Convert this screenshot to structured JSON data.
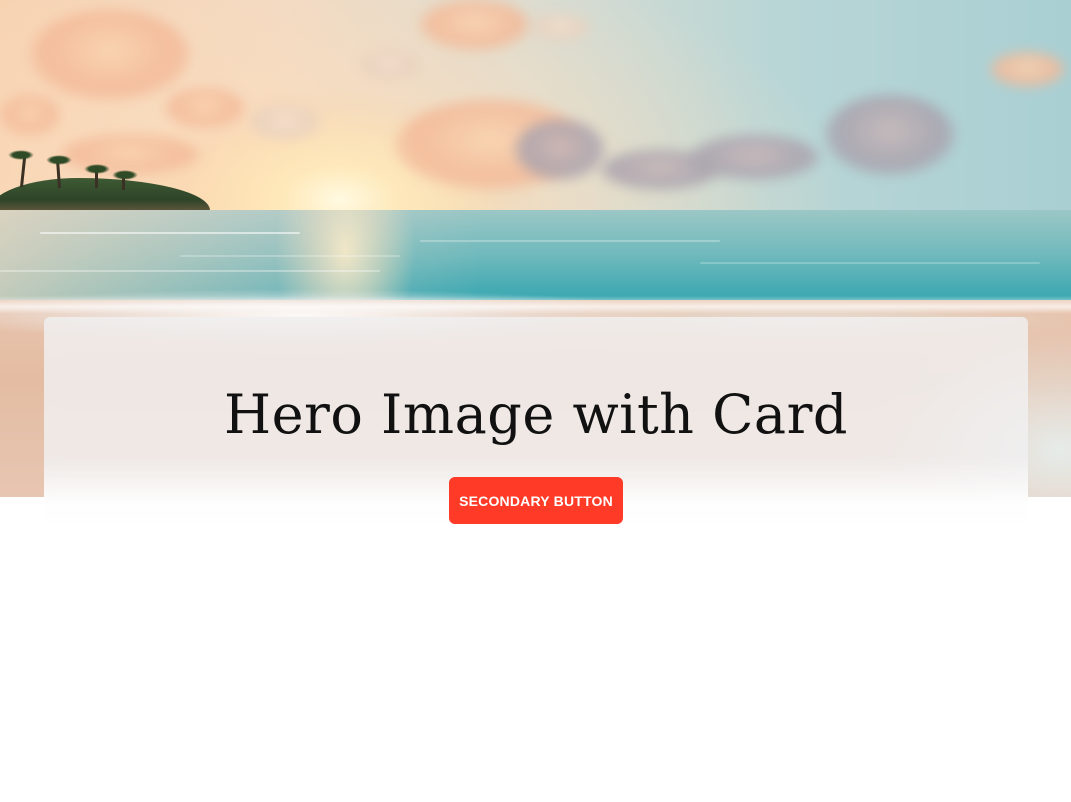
{
  "hero": {
    "image": {
      "description_icon": "beach-sunset-image"
    }
  },
  "card": {
    "title": "Hero Image with Card",
    "button_label": "SECONDARY BUTTON"
  },
  "colors": {
    "button_bg": "#ff3a26",
    "button_text": "#ffffff",
    "title_text": "#111111",
    "page_bg": "#ffffff"
  }
}
